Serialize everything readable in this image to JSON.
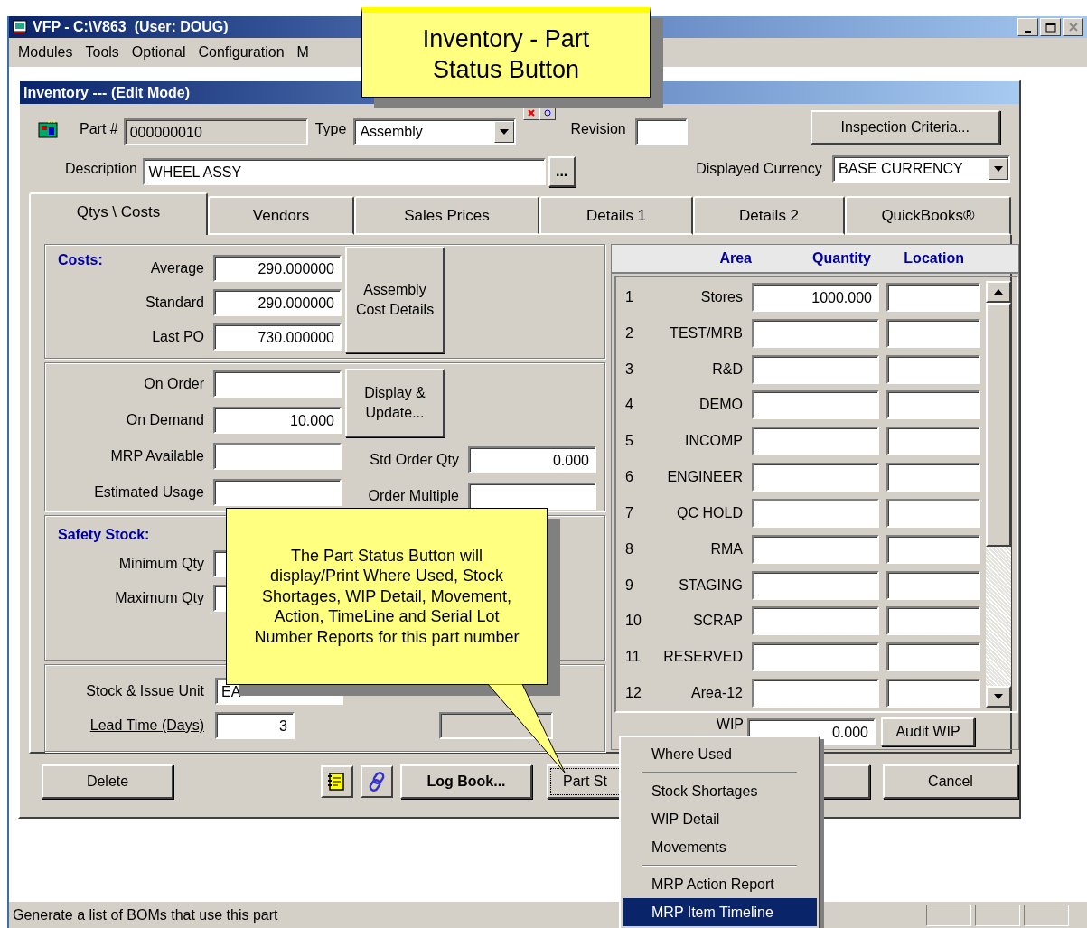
{
  "window": {
    "title": "VFP - C:\\V863  (User: DOUG)"
  },
  "menu": [
    "Modules",
    "Tools",
    "Optional",
    "Configuration",
    "M"
  ],
  "form": {
    "title": "Inventory --- (Edit Mode)",
    "part_number": {
      "label": "Part #",
      "value": "000000010",
      "disabled": true
    },
    "type": {
      "label": "Type",
      "value": "Assembly"
    },
    "revision": {
      "label": "Revision"
    },
    "inspection_button": "Inspection Criteria...",
    "description": {
      "label": "Description",
      "value": "WHEEL ASSY"
    },
    "more_button": "...",
    "currency": {
      "label": "Displayed Currency",
      "value": "BASE CURRENCY"
    }
  },
  "tabs": [
    {
      "label": "Qtys \\ Costs",
      "selected": true
    },
    {
      "label": "Vendors",
      "selected": false
    },
    {
      "label": "Sales Prices",
      "selected": false
    },
    {
      "label": "Details 1",
      "selected": false
    },
    {
      "label": "Details 2",
      "selected": false
    },
    {
      "label": "QuickBooks®",
      "selected": false
    }
  ],
  "costs": {
    "heading": "Costs:",
    "rows": [
      {
        "label": "Average",
        "value": "290.000000"
      },
      {
        "label": "Standard",
        "value": "290.000000"
      },
      {
        "label": "Last PO",
        "value": "730.000000"
      }
    ],
    "button": "Assembly Cost Details"
  },
  "orders": {
    "rows": [
      {
        "label": "On Order"
      },
      {
        "label": "On Demand",
        "value": "10.000"
      },
      {
        "label": "MRP Available"
      },
      {
        "label": "Estimated Usage"
      }
    ],
    "button": "Display & Update...",
    "right_rows": [
      {
        "label": "Std Order Qty",
        "value": "0.000"
      },
      {
        "label": "Order Multiple"
      }
    ]
  },
  "safety_stock": {
    "heading": "Safety Stock:",
    "rows": [
      {
        "label": "Minimum Qty"
      },
      {
        "label": "Maximum Qty"
      }
    ]
  },
  "units": {
    "rows": [
      {
        "label": "Stock & Issue Unit",
        "value": "EA",
        "underlined": false
      },
      {
        "label": "Lead Time (Days)",
        "value": "3",
        "underlined": true
      }
    ]
  },
  "locations": {
    "columns": [
      "Area",
      "Quantity",
      "Location"
    ],
    "rows": [
      {
        "number": "1",
        "area": "Stores",
        "quantity": "1000.000"
      },
      {
        "number": "2",
        "area": "TEST/MRB"
      },
      {
        "number": "3",
        "area": "R&D"
      },
      {
        "number": "4",
        "area": "DEMO"
      },
      {
        "number": "5",
        "area": "INCOMP"
      },
      {
        "number": "6",
        "area": "ENGINEER"
      },
      {
        "number": "7",
        "area": "QC HOLD"
      },
      {
        "number": "8",
        "area": "RMA"
      },
      {
        "number": "9",
        "area": "STAGING"
      },
      {
        "number": "10",
        "area": "SCRAP"
      },
      {
        "number": "11",
        "area": "RESERVED"
      },
      {
        "number": "12",
        "area": "Area-12"
      }
    ],
    "wip": {
      "label": "WIP",
      "value": "0.000",
      "button": "Audit WIP"
    }
  },
  "buttons": {
    "delete": "Delete",
    "log_book": "Log Book...",
    "part_status": "Part St",
    "cancel": "Cancel"
  },
  "part_status_menu": [
    {
      "kind": "item",
      "label": "Where Used",
      "selected": false
    },
    {
      "kind": "separator"
    },
    {
      "kind": "item",
      "label": "Stock Shortages",
      "selected": false
    },
    {
      "kind": "item",
      "label": "WIP Detail",
      "selected": false
    },
    {
      "kind": "item",
      "label": "Movements",
      "selected": false
    },
    {
      "kind": "separator"
    },
    {
      "kind": "item",
      "label": "MRP Action Report",
      "selected": false
    },
    {
      "kind": "item",
      "label": "MRP Item Timeline",
      "selected": true
    }
  ],
  "status_bar": {
    "message": "Generate a list of BOMs that use this part"
  },
  "callouts": [
    {
      "text": "Inventory - Part Status Button"
    },
    {
      "text": "The Part Status Button will display/Print Where Used, Stock Shortages, WIP Detail, Movement, Action, TimeLine and Serial Lot Number Reports for this part number"
    }
  ]
}
